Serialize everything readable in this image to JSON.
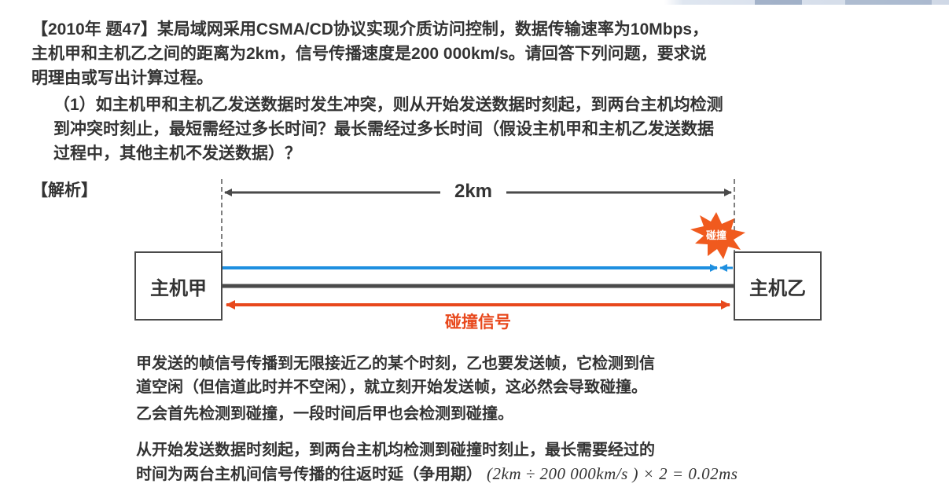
{
  "question": {
    "lines": [
      "【2010年 题47】某局域网采用CSMA/CD协议实现介质访问控制，数据传输速率为10Mbps，",
      "主机甲和主机乙之间的距离为2km，信号传播速度是200 000km/s。请回答下列问题，要求说",
      "明理由或写出计算过程。"
    ]
  },
  "sub_question": {
    "lines": [
      "（1）如主机甲和主机乙发送数据时发生冲突，则从开始发送数据时刻起，到两台主机均检测",
      "到冲突时刻止，最短需经过多长时间？最长需经过多长时间（假设主机甲和主机乙发送数据",
      "过程中，其他主机不发送数据）？"
    ]
  },
  "analysis_label": "【解析】",
  "diagram": {
    "distance_label": "2km",
    "host_a": "主机甲",
    "host_b": "主机乙",
    "collision_burst_label": "碰撞",
    "collision_signal_label": "碰撞信号",
    "colors": {
      "signal_a": "#1e8fe0",
      "collision": "#e8481c",
      "bus": "#4a4a4a"
    }
  },
  "explanation": {
    "para1": [
      "甲发送的帧信号传播到无限接近乙的某个时刻，乙也要发送帧，它检测到信",
      "道空闲（但信道此时并不空闲），就立刻开始发送帧，这必然会导致碰撞。"
    ],
    "para2": "乙会首先检测到碰撞，一段时间后甲也会检测到碰撞。",
    "para3_line1": "从开始发送数据时刻起，到两台主机均检测到碰撞时刻止，最长需要经过的",
    "para3_line2": "时间为两台主机间信号传播的往返时延（争用期）",
    "formula": "(2km ÷ 200 000km/s ) × 2 = 0.02ms"
  }
}
